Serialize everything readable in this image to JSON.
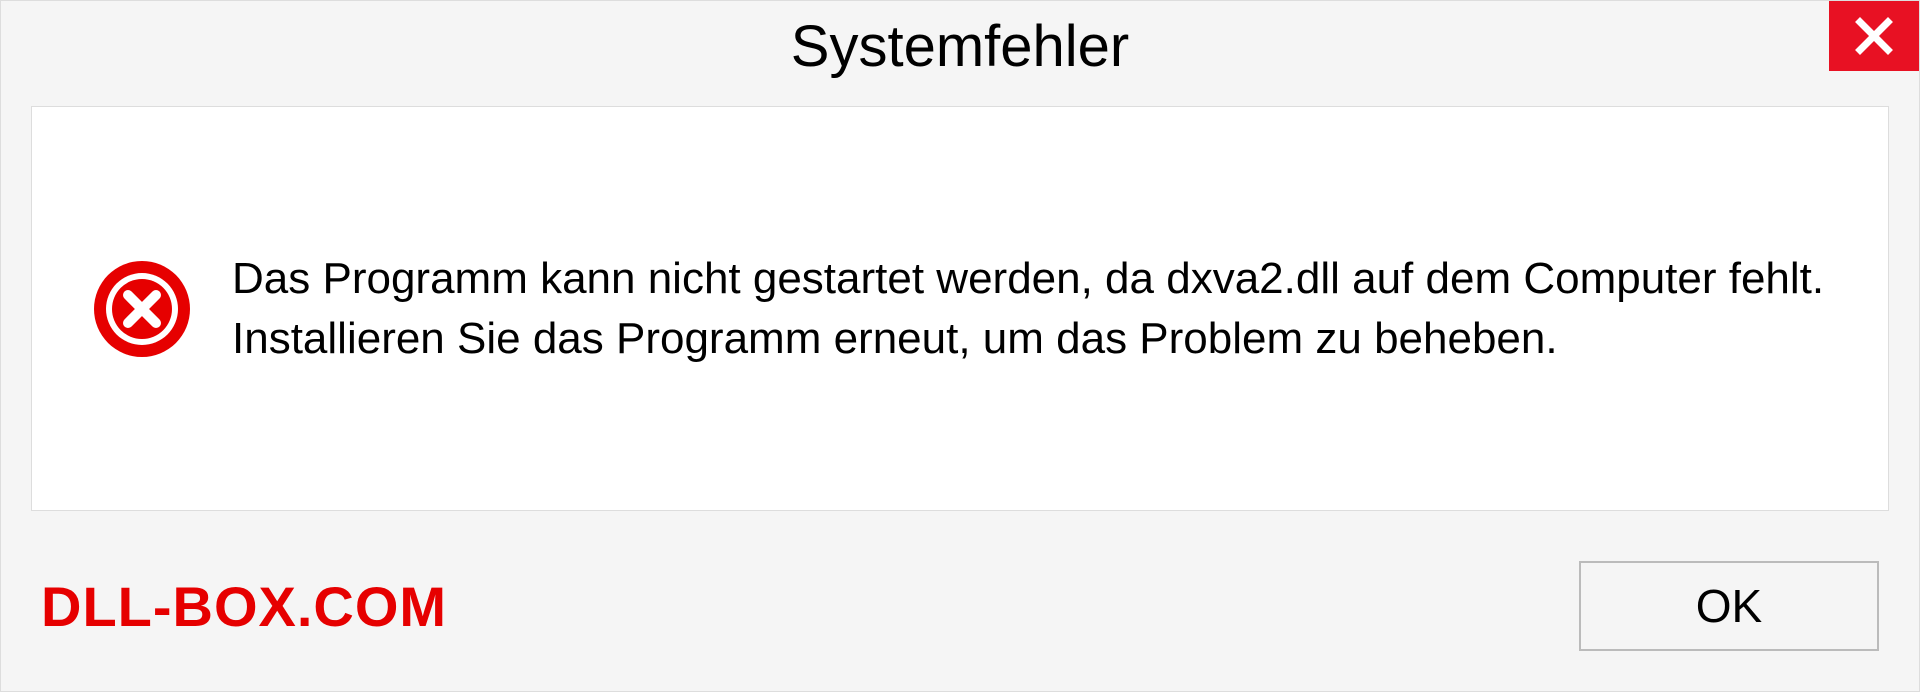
{
  "dialog": {
    "title": "Systemfehler",
    "message": "Das Programm kann nicht gestartet werden, da dxva2.dll auf dem Computer fehlt. Installieren Sie das Programm erneut, um das Problem zu beheben.",
    "ok_label": "OK"
  },
  "watermark": "DLL-BOX.COM",
  "colors": {
    "close_bg": "#e81123",
    "error_red": "#e60000",
    "watermark_red": "#e60000"
  }
}
